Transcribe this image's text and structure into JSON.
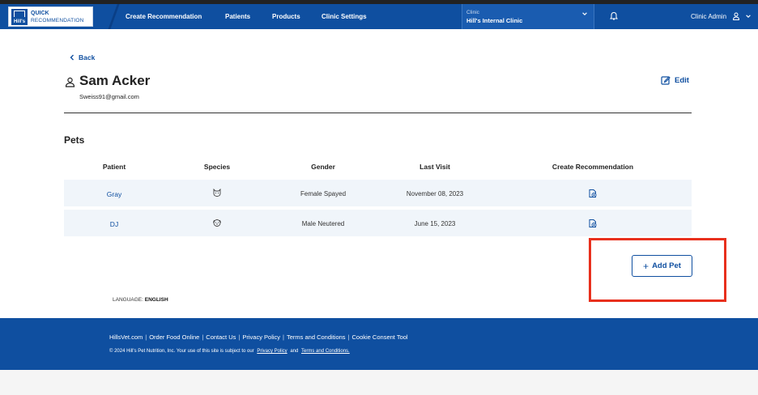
{
  "header": {
    "logo_line1": "QUICK",
    "logo_line2": "RECOMMENDATION",
    "logo_brand": "Hill's",
    "nav": [
      {
        "label": "Create Recommendation"
      },
      {
        "label": "Patients"
      },
      {
        "label": "Products"
      },
      {
        "label": "Clinic Settings"
      }
    ],
    "clinic_label": "Clinic",
    "clinic_name": "Hill's Internal Clinic",
    "user_label": "Clinic Admin"
  },
  "back_label": "Back",
  "customer": {
    "name": "Sam Acker",
    "email": "Sweiss91@gmail.com"
  },
  "edit_label": "Edit",
  "pets": {
    "title": "Pets",
    "columns": [
      "Patient",
      "Species",
      "Gender",
      "Last Visit",
      "Create Recommendation"
    ],
    "rows": [
      {
        "patient": "Gray",
        "species_icon": "cat-icon",
        "gender": "Female Spayed",
        "last_visit": "November 08, 2023"
      },
      {
        "patient": "DJ",
        "species_icon": "dog-icon",
        "gender": "Male Neutered",
        "last_visit": "June 15, 2023"
      }
    ]
  },
  "add_pet_label": "Add Pet",
  "language": {
    "label": "LANGUAGE:",
    "value": "ENGLISH"
  },
  "footer": {
    "links": [
      "HillsVet.com",
      "Order Food Online",
      "Contact Us",
      "Privacy Policy",
      "Terms and Conditions",
      "Cookie Consent Tool"
    ],
    "copyright": "© 2024 Hill's Pet Nutrition, Inc. Your use of this site is subject to our",
    "privacy_link": "Privacy Policy",
    "and_text": "and",
    "terms_link": "Terms and Conditions."
  },
  "colors": {
    "brand_blue": "#0f4fa0",
    "highlight_red": "#e8301d",
    "row_bg": "#f0f5fa"
  }
}
